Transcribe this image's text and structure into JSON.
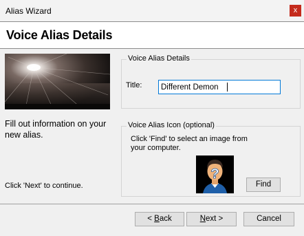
{
  "window": {
    "title": "Alias Wizard",
    "close_glyph": "x"
  },
  "header": {
    "title": "Voice Alias Details"
  },
  "left": {
    "instructions": "Fill out information on your new alias.",
    "continue_hint": "Click 'Next' to continue."
  },
  "details_group": {
    "label": "Voice Alias Details",
    "title_label": "Title:",
    "title_value": "Different Demon"
  },
  "icon_group": {
    "label": "Voice Alias Icon (optional)",
    "hint": "Click 'Find' to select an image from your computer.",
    "find_label": "Find",
    "icon": "question-face-avatar-icon"
  },
  "footer": {
    "back_prefix": "< ",
    "back_accel": "B",
    "back_rest": "ack",
    "next_accel": "N",
    "next_rest": "ext >",
    "cancel_label": "Cancel"
  },
  "colors": {
    "close_button": "#c42b1c",
    "input_focus_border": "#0078d7",
    "dialog_bg": "#f0f0f0"
  }
}
